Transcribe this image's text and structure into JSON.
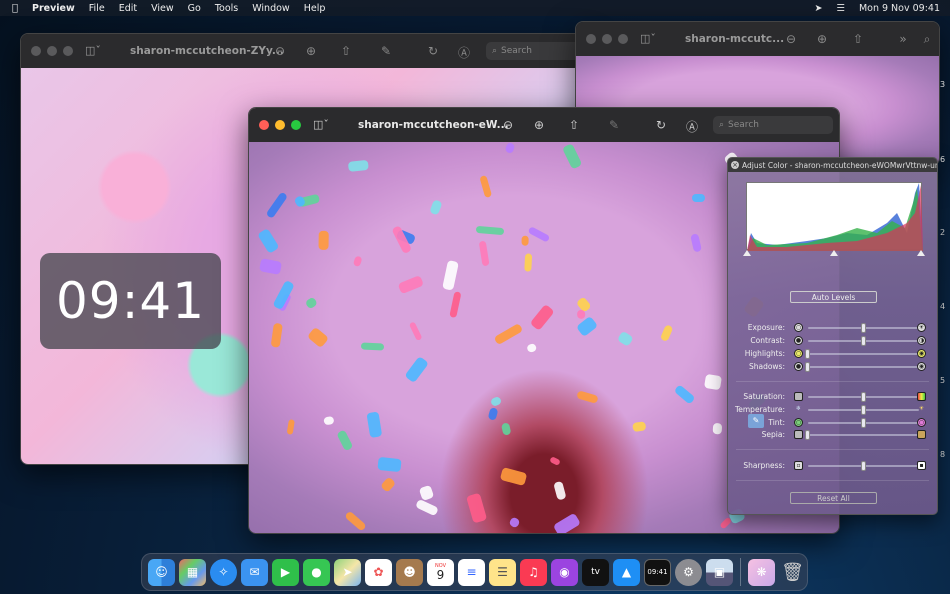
{
  "menubar": {
    "apple": "",
    "app": "Preview",
    "items": [
      "File",
      "Edit",
      "View",
      "Go",
      "Tools",
      "Window",
      "Help"
    ],
    "datetime": "Mon 9 Nov  09:41"
  },
  "windows": {
    "back_left_title": "sharon-mccutcheon-ZYy...",
    "back_right_title": "sharon-mccutc...",
    "front_title": "sharon-mccutcheon-eW...",
    "search_placeholder": "Search"
  },
  "clock": {
    "time": "09:41"
  },
  "adjust_panel": {
    "title": "Adjust Color - sharon-mccutcheon-eWOMwrVttnw-uns...",
    "auto_levels": "Auto Levels",
    "reset_all": "Reset All",
    "sliders": [
      {
        "label": "Exposure:",
        "value": 0.5
      },
      {
        "label": "Contrast:",
        "value": 0.5
      },
      {
        "label": "Highlights:",
        "value": 0.0
      },
      {
        "label": "Shadows:",
        "value": 0.0
      },
      {
        "label": "Saturation:",
        "value": 0.5
      },
      {
        "label": "Temperature:",
        "value": 0.5
      },
      {
        "label": "Tint:",
        "value": 0.5
      },
      {
        "label": "Sepia:",
        "value": 0.0
      },
      {
        "label": "Sharpness:",
        "value": 0.5
      }
    ]
  },
  "side_numbers": [
    "3",
    "6",
    "2",
    "4",
    "5",
    "8"
  ],
  "dock": {
    "calendar_month": "NOV",
    "calendar_day": "9",
    "clock_app": "09:41",
    "apple_tv": "tv",
    "items": [
      "finder-icon",
      "launchpad-icon",
      "safari-icon",
      "mail-icon",
      "facetime-icon",
      "messages-icon",
      "maps-icon",
      "photos-icon",
      "contacts-icon",
      "calendar-icon",
      "reminders-icon",
      "notes-icon",
      "music-icon",
      "podcasts-icon",
      "tv-icon",
      "app-store-icon",
      "clock-icon",
      "system-preferences-icon",
      "preview-icon",
      "sprinkles-folder-icon",
      "trash-icon"
    ]
  }
}
